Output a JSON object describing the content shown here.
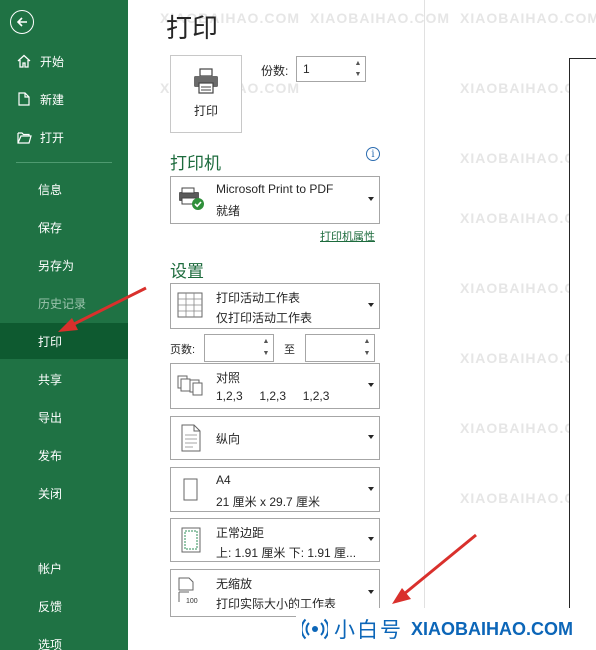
{
  "sidebar": {
    "items": [
      {
        "label": "开始",
        "icon": "home-icon"
      },
      {
        "label": "新建",
        "icon": "new-file-icon"
      },
      {
        "label": "打开",
        "icon": "folder-open-icon"
      },
      {
        "label": "信息"
      },
      {
        "label": "保存"
      },
      {
        "label": "另存为"
      },
      {
        "label": "历史记录",
        "state": "disabled"
      },
      {
        "label": "打印",
        "state": "active"
      },
      {
        "label": "共享"
      },
      {
        "label": "导出"
      },
      {
        "label": "发布"
      },
      {
        "label": "关闭"
      },
      {
        "label": "帐户"
      },
      {
        "label": "反馈"
      },
      {
        "label": "选项"
      }
    ]
  },
  "main": {
    "title": "打印",
    "print_button": "打印",
    "copies_label": "份数:",
    "copies_value": "1",
    "printer_section": "打印机",
    "printer": {
      "name": "Microsoft Print to PDF",
      "status": "就绪"
    },
    "printer_properties": "打印机属性",
    "settings_section": "设置",
    "scope": {
      "line1": "打印活动工作表",
      "line2": "仅打印活动工作表"
    },
    "pages_label": "页数:",
    "pages_to": "至",
    "collate": {
      "line1": "对照",
      "line2": "1,2,3     1,2,3     1,2,3"
    },
    "orientation": {
      "line1": "纵向"
    },
    "paper": {
      "line1": "A4",
      "line2": "21 厘米 x 29.7 厘米"
    },
    "margins": {
      "line1": "正常边距",
      "line2": "上: 1.91 厘米 下: 1.91 厘..."
    },
    "scaling": {
      "line1": "无缩放",
      "line2": "打印实际大小的工作表"
    }
  },
  "watermark": {
    "site": "XIAOBAIHAO.COM",
    "brand_name": "小白号",
    "brand_url": "XIAOBAIHAO.COM"
  },
  "colors": {
    "sidebar": "#1f7244",
    "active": "#0e5a30",
    "accent": "#1d6b3d",
    "arrow": "#d9302c",
    "brand": "#0c66b8"
  }
}
